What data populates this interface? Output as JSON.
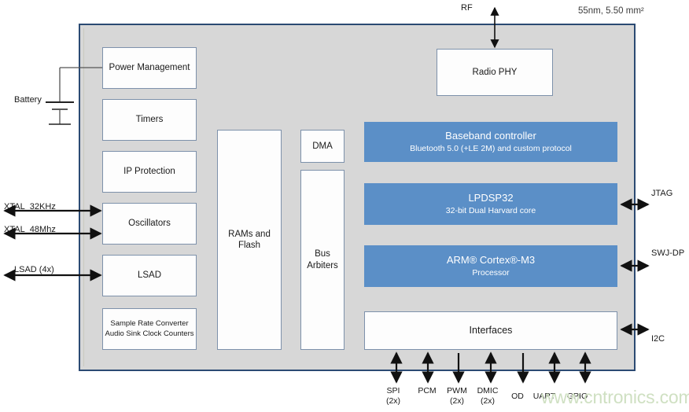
{
  "diagram": {
    "title_note": "55nm, 5.50 mm²",
    "watermark": "www.cntronics.com",
    "accent_blue": "#5b8fc7",
    "frame_border": "#2b4a73",
    "frame_fill": "#d7d7d7",
    "box_border": "#7d91ab"
  },
  "external": {
    "rf_label": "RF",
    "battery_label": "Battery",
    "left_pins": [
      {
        "label": "XTAL_32KHz"
      },
      {
        "label": "XTAL_48Mhz"
      },
      {
        "label": "LSAD (4x)"
      }
    ],
    "right_pins": [
      {
        "label": "JTAG"
      },
      {
        "label": "SWJ-DP"
      },
      {
        "label": "I2C"
      }
    ],
    "bottom_pins": [
      {
        "label": "SPI",
        "sub": "(2x)",
        "arrow": "both"
      },
      {
        "label": "PCM",
        "sub": "",
        "arrow": "both"
      },
      {
        "label": "PWM",
        "sub": "(2x)",
        "arrow": "down"
      },
      {
        "label": "DMIC",
        "sub": "(2x)",
        "arrow": "both"
      },
      {
        "label": "OD",
        "sub": "",
        "arrow": "down"
      },
      {
        "label": "UART",
        "sub": "",
        "arrow": "both"
      },
      {
        "label": "GPIO",
        "sub": "",
        "arrow": "both"
      }
    ]
  },
  "blocks": {
    "left_column": [
      {
        "label": "Power Management"
      },
      {
        "label": "Timers"
      },
      {
        "label": "IP Protection"
      },
      {
        "label": "Oscillators"
      },
      {
        "label": "LSAD"
      }
    ],
    "sample_rate_converter": {
      "line1": "Sample Rate Converter",
      "line2": "Audio Sink Clock Counters"
    },
    "memory": {
      "line1": "RAMs and",
      "line2": "Flash"
    },
    "dma": {
      "label": "DMA"
    },
    "bus_arbiters": {
      "line1": "Bus",
      "line2": "Arbiters"
    },
    "radio_phy": {
      "label": "Radio PHY"
    },
    "baseband": {
      "title": "Baseband controller",
      "subtitle": "Bluetooth 5.0 (+LE 2M) and custom protocol"
    },
    "dsp": {
      "title": "LPDSP32",
      "subtitle": "32-bit Dual Harvard core"
    },
    "cpu": {
      "title": "ARM® Cortex®-M3",
      "subtitle": "Processor"
    },
    "interfaces": {
      "label": "Interfaces"
    }
  }
}
